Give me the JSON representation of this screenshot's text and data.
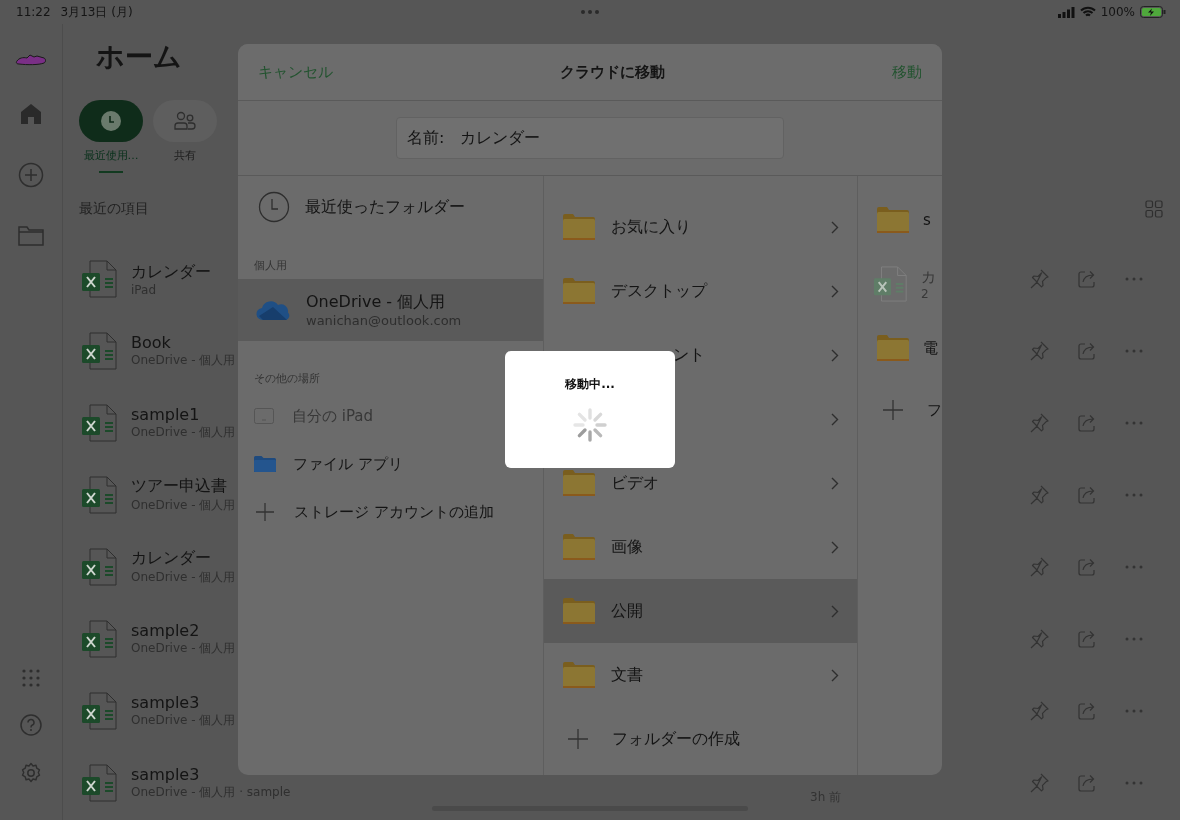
{
  "status_bar": {
    "time": "11:22",
    "date": "3月13日 (月)",
    "battery": "100%"
  },
  "title": "ホーム",
  "filters": [
    {
      "label": "最近使用…",
      "selected": true,
      "kind": "recent"
    },
    {
      "label": "共有",
      "selected": false,
      "kind": "shared"
    }
  ],
  "section_title": "最近の項目",
  "files": [
    {
      "name": "カレンダー",
      "location": "iPad"
    },
    {
      "name": "Book",
      "location": "OneDrive - 個人用"
    },
    {
      "name": "sample1",
      "location": "OneDrive - 個人用"
    },
    {
      "name": "ツアー申込書",
      "location": "OneDrive - 個人用"
    },
    {
      "name": "カレンダー",
      "location": "OneDrive - 個人用"
    },
    {
      "name": "sample2",
      "location": "OneDrive - 個人用"
    },
    {
      "name": "sample3",
      "location": "OneDrive - 個人用"
    },
    {
      "name": "sample3",
      "location": "OneDrive - 個人用 · sample",
      "time": "3h 前"
    }
  ],
  "dialog": {
    "cancel": "キャンセル",
    "title": "クラウドに移動",
    "confirm": "移動",
    "name_label": "名前:",
    "name_value": "カレンダー",
    "recent": "最近使ったフォルダー",
    "groups": [
      {
        "heading": "個人用",
        "items": [
          {
            "kind": "account",
            "title": "OneDrive - 個人用",
            "subtitle": "wanichan@outlook.com",
            "selected": true,
            "disabled": false
          }
        ]
      },
      {
        "heading": "その他の場所",
        "items": [
          {
            "kind": "device",
            "title": "自分の iPad",
            "selected": false,
            "disabled": true
          },
          {
            "kind": "files",
            "title": "ファイル アプリ",
            "selected": false,
            "disabled": false
          },
          {
            "kind": "add",
            "title": "ストレージ アカウントの追加",
            "selected": false,
            "disabled": false
          }
        ]
      }
    ],
    "folders": [
      {
        "label": "お気に入り",
        "selected": false,
        "covered": false
      },
      {
        "label": "デスクトップ",
        "selected": false,
        "covered": false
      },
      {
        "label": "ント",
        "selected": false,
        "covered": true
      },
      {
        "selected": false
      },
      {
        "label": "ビデオ",
        "selected": false,
        "covered": false
      },
      {
        "label": "画像",
        "selected": false,
        "covered": false
      },
      {
        "label": "公開",
        "selected": true,
        "covered": false
      },
      {
        "label": "文書",
        "selected": false,
        "covered": false
      }
    ],
    "create_folder": "フォルダーの作成",
    "preview": [
      {
        "kind": "folder",
        "label": "s"
      },
      {
        "kind": "file",
        "label": "カ",
        "sub": "2"
      },
      {
        "kind": "folder",
        "label": "電"
      },
      {
        "kind": "add",
        "label": "フ"
      }
    ]
  },
  "progress": {
    "message": "移動中..."
  }
}
